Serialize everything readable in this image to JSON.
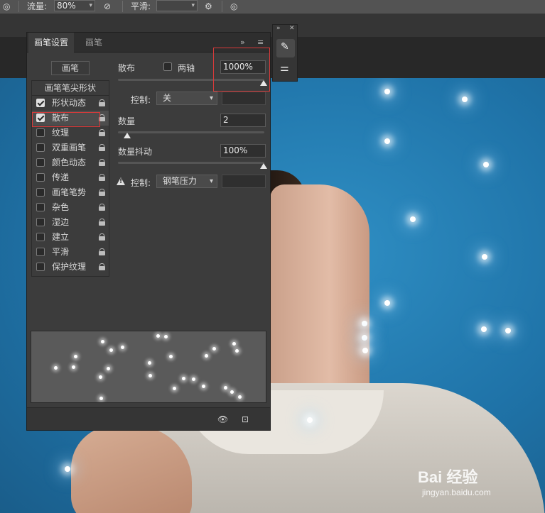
{
  "optbar": {
    "flow_label": "流量:",
    "flow_value": "80%",
    "smooth_label": "平滑:"
  },
  "panel": {
    "tabs": [
      "画笔设置",
      "画笔"
    ],
    "brush_button": "画笔",
    "list_header": "画笔笔尖形状",
    "items": [
      {
        "label": "形状动态",
        "checked": true
      },
      {
        "label": "散布",
        "checked": true
      },
      {
        "label": "纹理",
        "checked": false
      },
      {
        "label": "双重画笔",
        "checked": false
      },
      {
        "label": "颜色动态",
        "checked": false
      },
      {
        "label": "传递",
        "checked": false
      },
      {
        "label": "画笔笔势",
        "checked": false
      },
      {
        "label": "杂色",
        "checked": false
      },
      {
        "label": "湿边",
        "checked": false
      },
      {
        "label": "建立",
        "checked": false
      },
      {
        "label": "平滑",
        "checked": false
      },
      {
        "label": "保护纹理",
        "checked": false
      }
    ],
    "scatter": {
      "label": "散布",
      "both_axes_label": "两轴",
      "value": "1000%",
      "control_label": "控制:",
      "control_value": "关"
    },
    "count": {
      "label": "数量",
      "value": "2"
    },
    "count_jitter": {
      "label": "数量抖动",
      "value": "100%",
      "control_label": "控制:",
      "control_value": "钢笔压力"
    }
  },
  "watermark": {
    "brand": "Bai 经验",
    "url": "jingyan.baidu.com"
  },
  "colors": {
    "highlight": "#d83a3a",
    "panel_bg": "#3c3c3c",
    "canvas_blue": "#1f73a8"
  }
}
